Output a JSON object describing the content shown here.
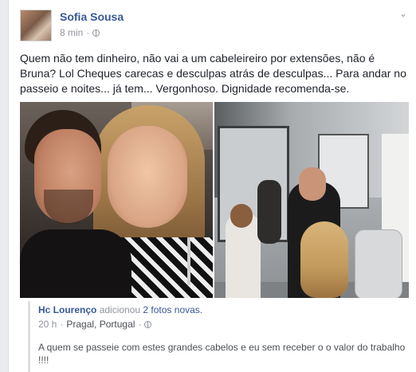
{
  "post": {
    "author": "Sofia Sousa",
    "time": "8 min",
    "separator": "·",
    "body": "Quem não tem dinheiro, não vai a um cabeleireiro por extensões, não é Bruna? Lol Cheques carecas e desculpas atrás de desculpas... Para andar no passeio e noites... já tem... Vergonhoso. Dignidade recomenda-se."
  },
  "shared": {
    "author": "Hc Lourenço",
    "action": "adicionou",
    "target": "2 fotos novas.",
    "time": "20 h",
    "separator": "·",
    "place": "Pragal, Portugal",
    "separator2": "·",
    "text": "A quem se passeie com estes grandes cabelos e eu sem receber o o valor do trabalho !!!!"
  },
  "icons": {
    "options": "chevron-down-icon",
    "privacy": "globe-icon"
  },
  "colors": {
    "link": "#365899",
    "meta": "#90949c",
    "text": "#1d2129"
  }
}
